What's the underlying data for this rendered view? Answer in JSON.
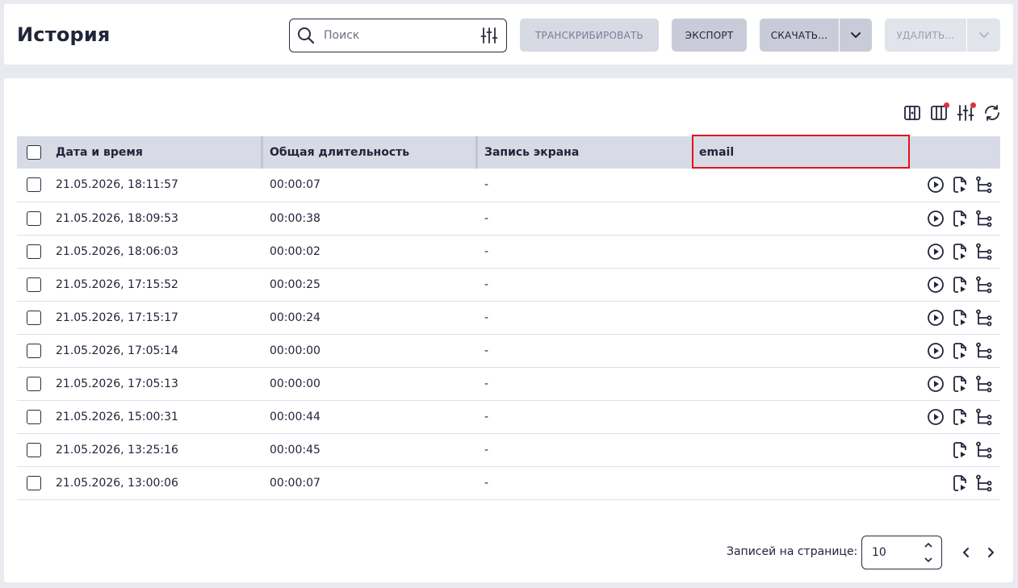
{
  "header": {
    "title": "История",
    "search_placeholder": "Поиск",
    "transcribe_label": "ТРАНСКРИБИРОВАТЬ",
    "export_label": "ЭКСПОРТ",
    "download_label": "СКАЧАТЬ...",
    "delete_label": "УДАЛИТЬ..."
  },
  "table": {
    "columns": [
      "Дата и время",
      "Общая длительность",
      "Запись экрана",
      "email"
    ],
    "rows": [
      {
        "date": "21.05.2026, 18:11:57",
        "duration": "00:00:07",
        "screen": "-",
        "email": "",
        "has_play": true
      },
      {
        "date": "21.05.2026, 18:09:53",
        "duration": "00:00:38",
        "screen": "-",
        "email": "",
        "has_play": true
      },
      {
        "date": "21.05.2026, 18:06:03",
        "duration": "00:00:02",
        "screen": "-",
        "email": "",
        "has_play": true
      },
      {
        "date": "21.05.2026, 17:15:52",
        "duration": "00:00:25",
        "screen": "-",
        "email": "",
        "has_play": true
      },
      {
        "date": "21.05.2026, 17:15:17",
        "duration": "00:00:24",
        "screen": "-",
        "email": "",
        "has_play": true
      },
      {
        "date": "21.05.2026, 17:05:14",
        "duration": "00:00:00",
        "screen": "-",
        "email": "",
        "has_play": true
      },
      {
        "date": "21.05.2026, 17:05:13",
        "duration": "00:00:00",
        "screen": "-",
        "email": "",
        "has_play": true
      },
      {
        "date": "21.05.2026, 15:00:31",
        "duration": "00:00:44",
        "screen": "-",
        "email": "",
        "has_play": true
      },
      {
        "date": "21.05.2026, 13:25:16",
        "duration": "00:00:45",
        "screen": "-",
        "email": "",
        "has_play": false
      },
      {
        "date": "21.05.2026, 13:00:06",
        "duration": "00:00:07",
        "screen": "-",
        "email": "",
        "has_play": false
      }
    ]
  },
  "pager": {
    "label": "Записей на странице:",
    "page_size": "10"
  },
  "colors": {
    "highlight": "#e3121c",
    "header_row_bg": "#d8dbe5",
    "indicator_dot": "#d9333f"
  },
  "icons": {
    "toolbar": [
      "columns-icon",
      "columns-filter-icon",
      "filter-settings-icon",
      "refresh-icon"
    ],
    "row_actions": [
      "play-icon",
      "file-audio-icon",
      "flow-tree-icon"
    ]
  }
}
